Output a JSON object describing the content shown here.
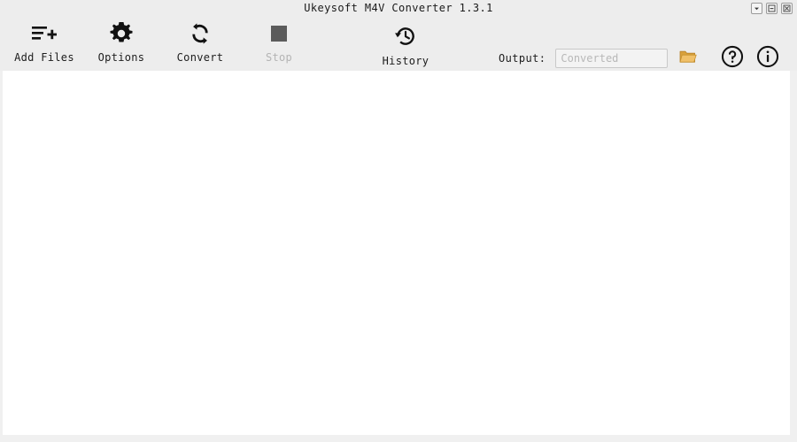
{
  "window": {
    "title": "Ukeysoft M4V Converter 1.3.1",
    "controls": [
      {
        "name": "menu-dropdown-button",
        "icon": "chevron-down-icon",
        "label": ""
      },
      {
        "name": "minimize-button",
        "icon": "minimize-icon",
        "label": ""
      },
      {
        "name": "close-button",
        "icon": "close-icon",
        "label": ""
      }
    ]
  },
  "toolbar": {
    "add_files": {
      "label": "Add Files",
      "icon": "add-files-icon",
      "enabled": true
    },
    "options": {
      "label": "Options",
      "icon": "gear-icon",
      "enabled": true
    },
    "convert": {
      "label": "Convert",
      "icon": "convert-refresh-icon",
      "enabled": true
    },
    "stop": {
      "label": "Stop",
      "icon": "stop-square-icon",
      "enabled": false
    },
    "history": {
      "label": "History",
      "icon": "history-clock-icon",
      "enabled": true
    }
  },
  "output": {
    "label": "Output:",
    "value": "",
    "placeholder": "Converted",
    "browse_icon": "folder-icon"
  },
  "help": {
    "icon": "question-circle-icon",
    "label": ""
  },
  "info": {
    "icon": "info-circle-icon",
    "label": ""
  },
  "main": {
    "empty_message": ""
  },
  "colors": {
    "toolbar_background": "#ededed",
    "content_background": "#ffffff",
    "icon_foreground": "#111111",
    "disabled_foreground": "#b4b4b4",
    "stop_square": "#5b5b5b",
    "folder_accent": "#e0a53a",
    "input_border": "#c9c9c9",
    "placeholder_text": "#b8b8b8"
  }
}
